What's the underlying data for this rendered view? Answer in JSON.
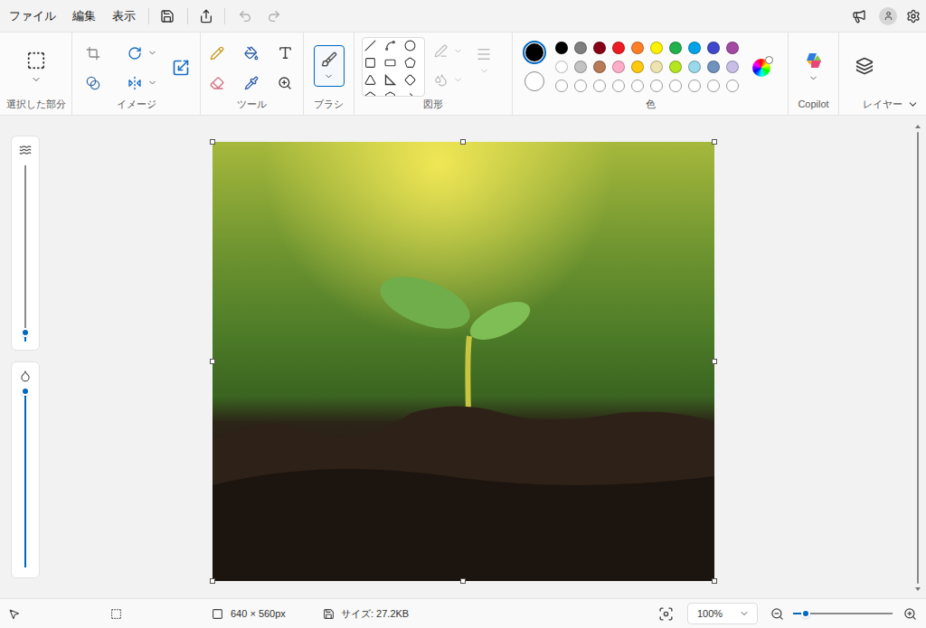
{
  "menu": [
    {
      "label": "ファイル"
    },
    {
      "label": "編集"
    },
    {
      "label": "表示"
    }
  ],
  "quick_access": {
    "undo_disabled": true,
    "redo_disabled": true
  },
  "ribbon": {
    "groups": [
      {
        "label": "選択した部分"
      },
      {
        "label": "イメージ"
      },
      {
        "label": "ツール"
      },
      {
        "label": "ブラシ"
      },
      {
        "label": "図形"
      },
      {
        "label": "色"
      },
      {
        "label": "Copilot"
      },
      {
        "label": "レイヤー"
      }
    ],
    "brush_selected": true,
    "shape_outline_disabled": true,
    "shape_fill_disabled": true
  },
  "colors": {
    "primary": "#000000",
    "secondary": "#ffffff",
    "primary_selected": true,
    "swatches": [
      {
        "kind": "preset",
        "color": "#000000"
      },
      {
        "kind": "preset",
        "color": "#7f7f7f"
      },
      {
        "kind": "preset",
        "color": "#880015"
      },
      {
        "kind": "preset",
        "color": "#ed1c24"
      },
      {
        "kind": "preset",
        "color": "#ff7f27"
      },
      {
        "kind": "preset",
        "color": "#fff200"
      },
      {
        "kind": "preset",
        "color": "#22b14c"
      },
      {
        "kind": "preset",
        "color": "#00a2e8"
      },
      {
        "kind": "preset",
        "color": "#3f48cc"
      },
      {
        "kind": "preset",
        "color": "#a349a4"
      },
      {
        "kind": "preset",
        "color": "#ffffff"
      },
      {
        "kind": "preset",
        "color": "#c3c3c3"
      },
      {
        "kind": "preset",
        "color": "#b97a57"
      },
      {
        "kind": "preset",
        "color": "#ffaec9"
      },
      {
        "kind": "preset",
        "color": "#ffc90e"
      },
      {
        "kind": "preset",
        "color": "#efe4b0"
      },
      {
        "kind": "preset",
        "color": "#b5e61d"
      },
      {
        "kind": "preset",
        "color": "#99d9ea"
      },
      {
        "kind": "preset",
        "color": "#7092be"
      },
      {
        "kind": "preset",
        "color": "#c8bfe7"
      },
      {
        "kind": "empty"
      },
      {
        "kind": "empty"
      },
      {
        "kind": "empty"
      },
      {
        "kind": "empty"
      },
      {
        "kind": "empty"
      },
      {
        "kind": "empty"
      },
      {
        "kind": "empty"
      },
      {
        "kind": "empty"
      },
      {
        "kind": "empty"
      },
      {
        "kind": "empty"
      }
    ]
  },
  "sliders": {
    "size": {
      "level": 0.05
    },
    "opacity": {
      "level": 1
    }
  },
  "canvas": {
    "selected": true
  },
  "status_bar": {
    "dimensions": "640 × 560px",
    "file_size": "サイズ: 27.2KB",
    "zoom": "100%",
    "zoom_level": 0.13
  }
}
